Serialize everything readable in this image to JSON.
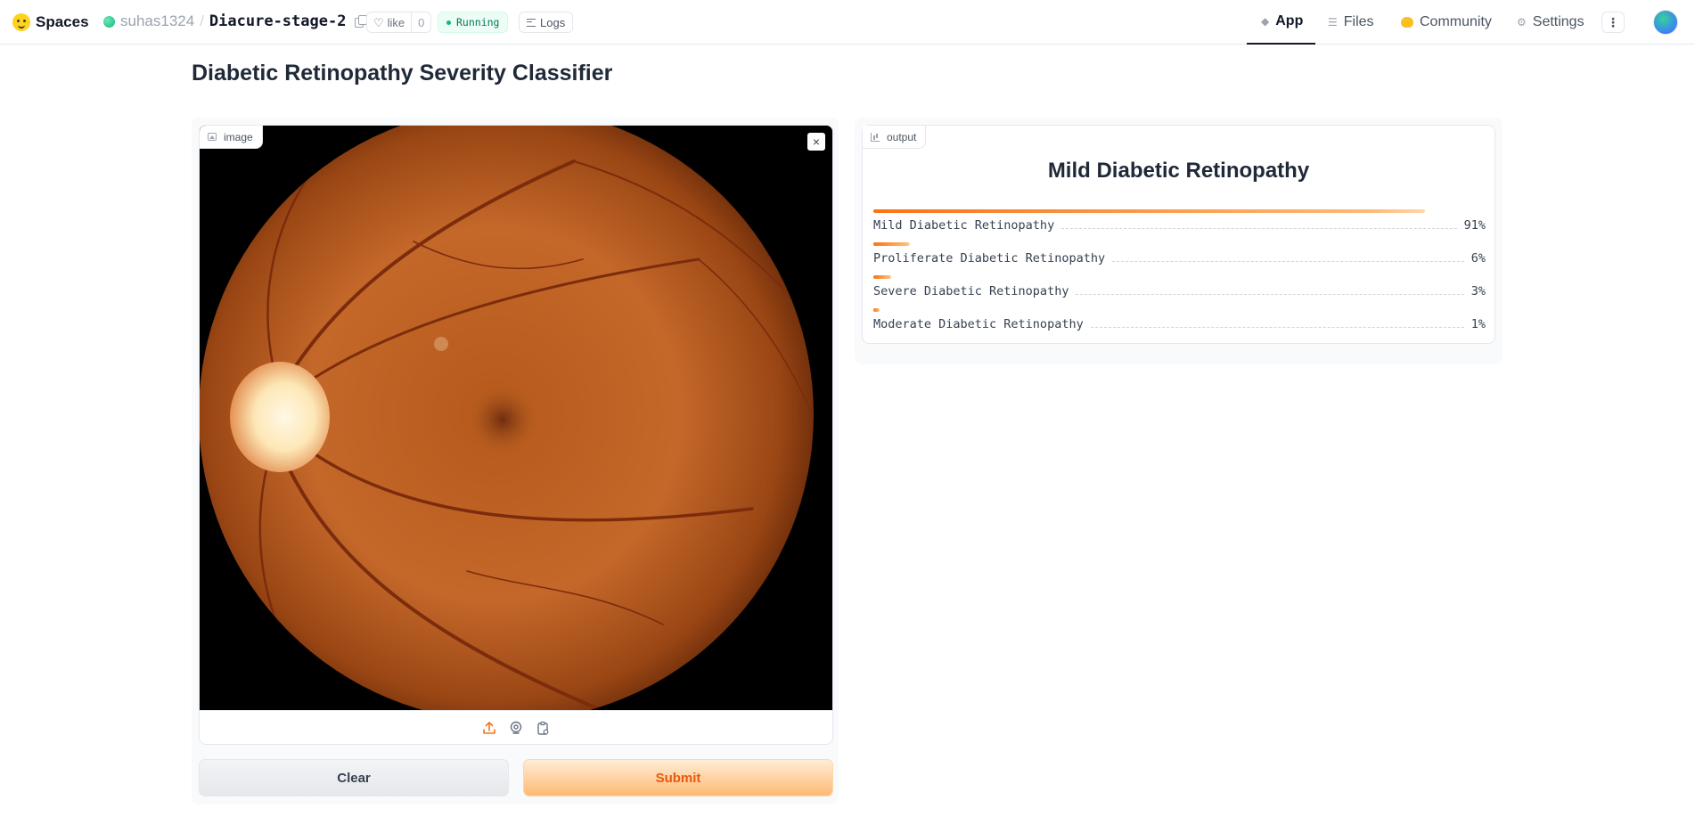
{
  "topbar": {
    "brand": "Spaces",
    "owner": "suhas1324",
    "separator": "/",
    "repo": "Diacure-stage-2",
    "like_label": "like",
    "like_count": "0",
    "status": "Running",
    "logs_label": "Logs",
    "nav": {
      "app": "App",
      "files": "Files",
      "community": "Community",
      "settings": "Settings"
    },
    "more_glyph": "⋮"
  },
  "page": {
    "title": "Diabetic Retinopathy Severity Classifier"
  },
  "input": {
    "label": "image",
    "clear_glyph": "×",
    "tools": [
      "upload-icon",
      "webcam-icon",
      "clipboard-icon"
    ]
  },
  "buttons": {
    "clear": "Clear",
    "submit": "Submit"
  },
  "output": {
    "label": "output",
    "predicted": "Mild Diabetic Retinopathy",
    "confidences": [
      {
        "name": "Mild Diabetic Retinopathy",
        "value": "91%",
        "fraction": 0.91
      },
      {
        "name": "Proliferate Diabetic Retinopathy",
        "value": "6%",
        "fraction": 0.06
      },
      {
        "name": "Severe Diabetic Retinopathy",
        "value": "3%",
        "fraction": 0.03
      },
      {
        "name": "Moderate Diabetic Retinopathy",
        "value": "1%",
        "fraction": 0.01
      }
    ]
  },
  "colors": {
    "accent": "#f97316",
    "running": "#10b981"
  }
}
